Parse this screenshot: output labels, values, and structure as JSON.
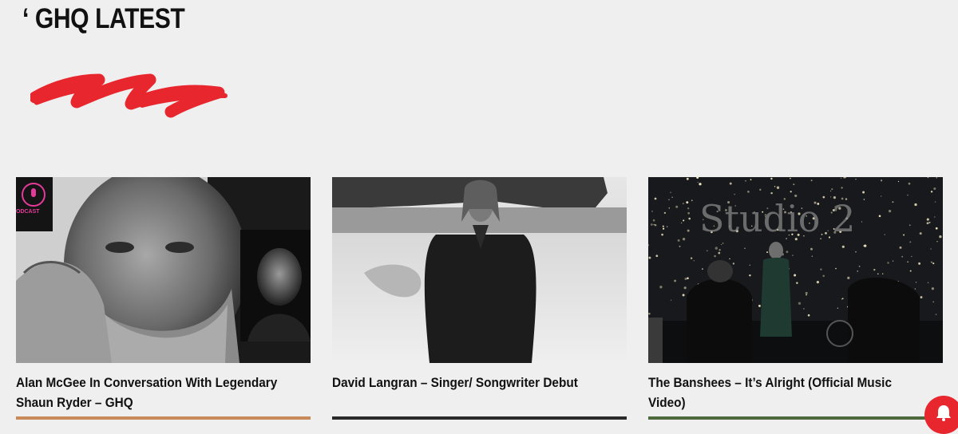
{
  "section": {
    "title": "‘ GHQ LATEST",
    "accent_color": "#e8262e",
    "decoration_icon": "red-squiggle-icon"
  },
  "posts": [
    {
      "title": "Alan McGee In Conversation With Legendary Shaun Ryder – GHQ",
      "image": "black-and-white portrait of bald bearded man with hand on face, inset of man with dark hair",
      "badge_text": "ODCAST"
    },
    {
      "title": "David Langran – Singer/ Songwriter Debut",
      "image": "black-and-white photo of man in jacket standing on beach"
    },
    {
      "title": "The Banshees – It’s Alright (Official Music Video)",
      "image": "band performing on dark stage with fairy lights",
      "sign_text": "Studio 2"
    }
  ],
  "floating_button": {
    "icon": "notification-bell-icon",
    "color": "#e8262e"
  }
}
